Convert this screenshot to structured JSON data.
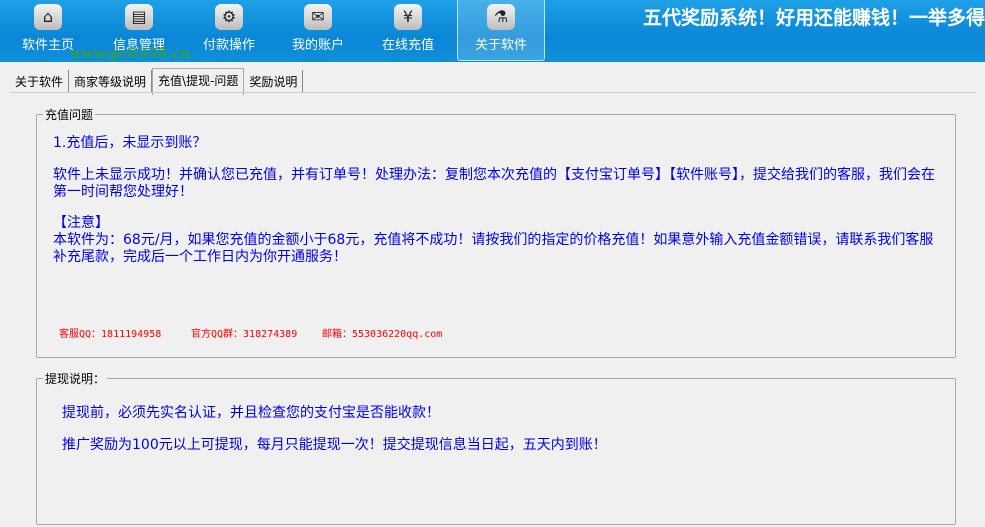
{
  "header": {
    "title": "五代奖励系统！好用还能赚钱！一举多得",
    "watermark": "www.pc0359.cn",
    "nav": [
      {
        "label": "软件主页",
        "icon": "home-icon",
        "glyph": "⌂"
      },
      {
        "label": "信息管理",
        "icon": "document-icon",
        "glyph": "▤"
      },
      {
        "label": "付款操作",
        "icon": "gear-icon",
        "glyph": "⚙"
      },
      {
        "label": "我的账户",
        "icon": "mail-icon",
        "glyph": "✉"
      },
      {
        "label": "在线充值",
        "icon": "yen-icon",
        "glyph": "¥"
      },
      {
        "label": "关于软件",
        "icon": "microscope-icon",
        "glyph": "⚗"
      }
    ]
  },
  "tabs": [
    "关于软件",
    "商家等级说明",
    "充值\\提现-问题",
    "奖励说明"
  ],
  "recharge": {
    "label": "充值问题",
    "q1": "1.充值后，未显示到账？",
    "p1": "软件上未显示成功！并确认您已充值，并有订单号！处理办法：复制您本次充值的【支付宝订单号】【软件账号】，提交给我们的客服，我们会在第一时间帮您处理好！",
    "note_title": "【注意】",
    "note": "本软件为：68元/月，如果您充值的金额小于68元，充值将不成功！请按我们的指定的价格充值！如果意外输入充值金额错误，请联系我们客服补充尾款，完成后一个工作日内为你开通服务！",
    "qq": "客服QQ：1811194958",
    "group": "官方QQ群：318274389",
    "email": "邮箱：553036220qq.com"
  },
  "withdraw": {
    "label": "提现说明：",
    "l1": "提现前，必须先实名认证，并且检查您的支付宝是否能收款！",
    "l2": "推广奖励为100元以上可提现，每月只能提现一次！提交提现信息当日起，五天内到账！"
  }
}
